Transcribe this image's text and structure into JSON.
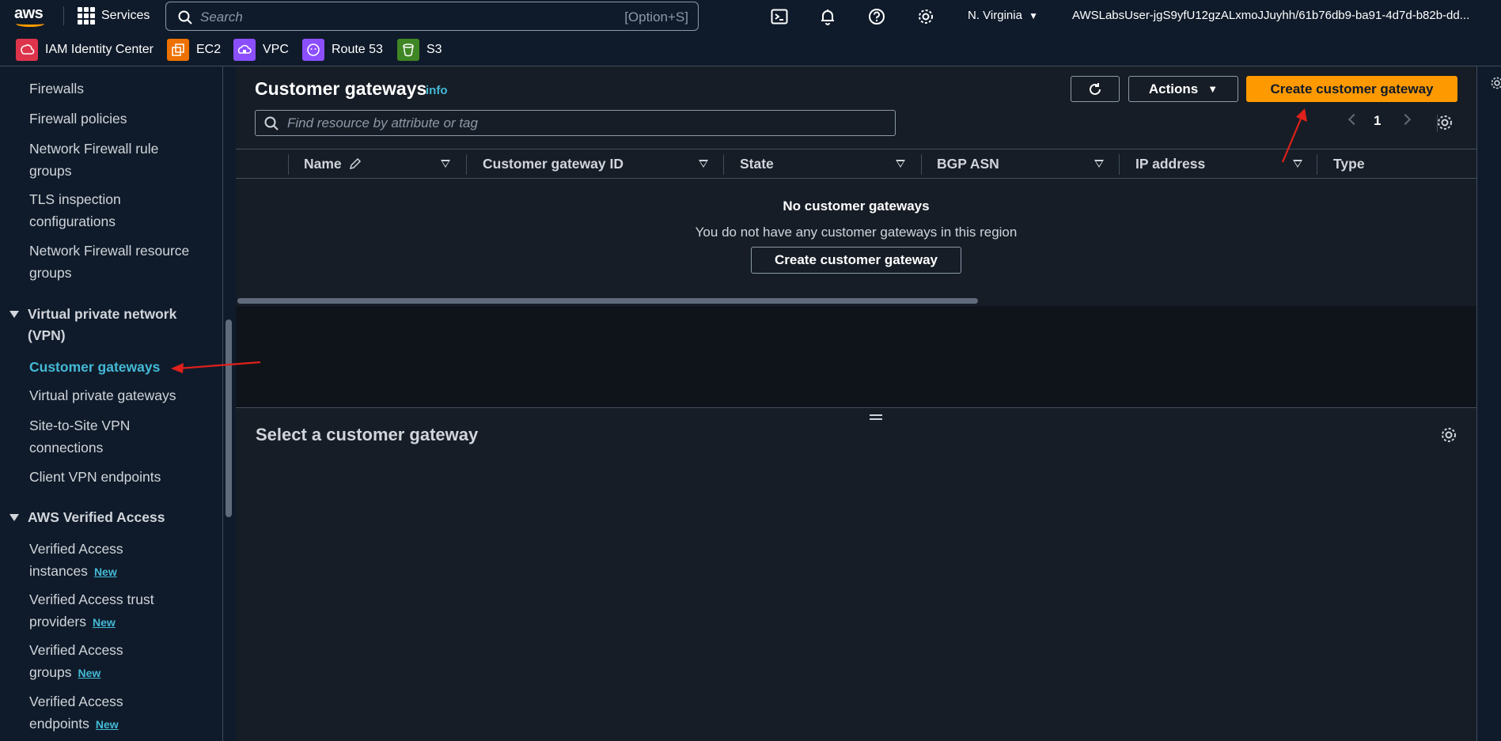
{
  "topnav": {
    "logo": "aws",
    "services_label": "Services",
    "search_placeholder": "Search",
    "search_shortcut": "[Option+S]",
    "region": "N. Virginia",
    "account": "AWSLabsUser-jgS9yfU12gzALxmoJJuyhh/61b76db9-ba91-4d7d-b82b-dd..."
  },
  "favorites": [
    {
      "label": "IAM Identity Center",
      "icon": "iam-identity-center-icon",
      "color": "#dd344c"
    },
    {
      "label": "EC2",
      "icon": "ec2-icon",
      "color": "#ed7100"
    },
    {
      "label": "VPC",
      "icon": "vpc-icon",
      "color": "#8c4fff"
    },
    {
      "label": "Route 53",
      "icon": "route53-icon",
      "color": "#8c4fff"
    },
    {
      "label": "S3",
      "icon": "s3-icon",
      "color": "#3f8624"
    }
  ],
  "sidebar": {
    "items": [
      {
        "label": "Firewalls"
      },
      {
        "label": "Firewall policies"
      },
      {
        "label": "Network Firewall rule groups"
      },
      {
        "label": "TLS inspection configurations"
      },
      {
        "label": "Network Firewall resource groups"
      }
    ],
    "vpn_section": "Virtual private network (VPN)",
    "vpn_items": [
      {
        "label": "Customer gateways"
      },
      {
        "label": "Virtual private gateways"
      },
      {
        "label": "Site-to-Site VPN connections"
      },
      {
        "label": "Client VPN endpoints"
      }
    ],
    "va_section": "AWS Verified Access",
    "va_items": [
      {
        "label": "Verified Access instances",
        "badge": "New"
      },
      {
        "label": "Verified Access trust providers",
        "badge": "New"
      },
      {
        "label": "Verified Access groups",
        "badge": "New"
      },
      {
        "label": "Verified Access endpoints",
        "badge": "New"
      }
    ]
  },
  "main": {
    "title": "Customer gateways",
    "info": "info",
    "actions_label": "Actions",
    "create_label": "Create customer gateway",
    "find_placeholder": "Find resource by attribute or tag",
    "page_number": "1",
    "columns": [
      "Name",
      "Customer gateway ID",
      "State",
      "BGP ASN",
      "IP address",
      "Type"
    ],
    "empty_title": "No customer gateways",
    "empty_desc": "You do not have any customer gateways in this region",
    "empty_create_label": "Create customer gateway",
    "detail_title": "Select a customer gateway"
  },
  "colors": {
    "accent_link": "#44b9d6",
    "primary_button": "#ff9900",
    "annotation_arrow": "#e0201b"
  }
}
